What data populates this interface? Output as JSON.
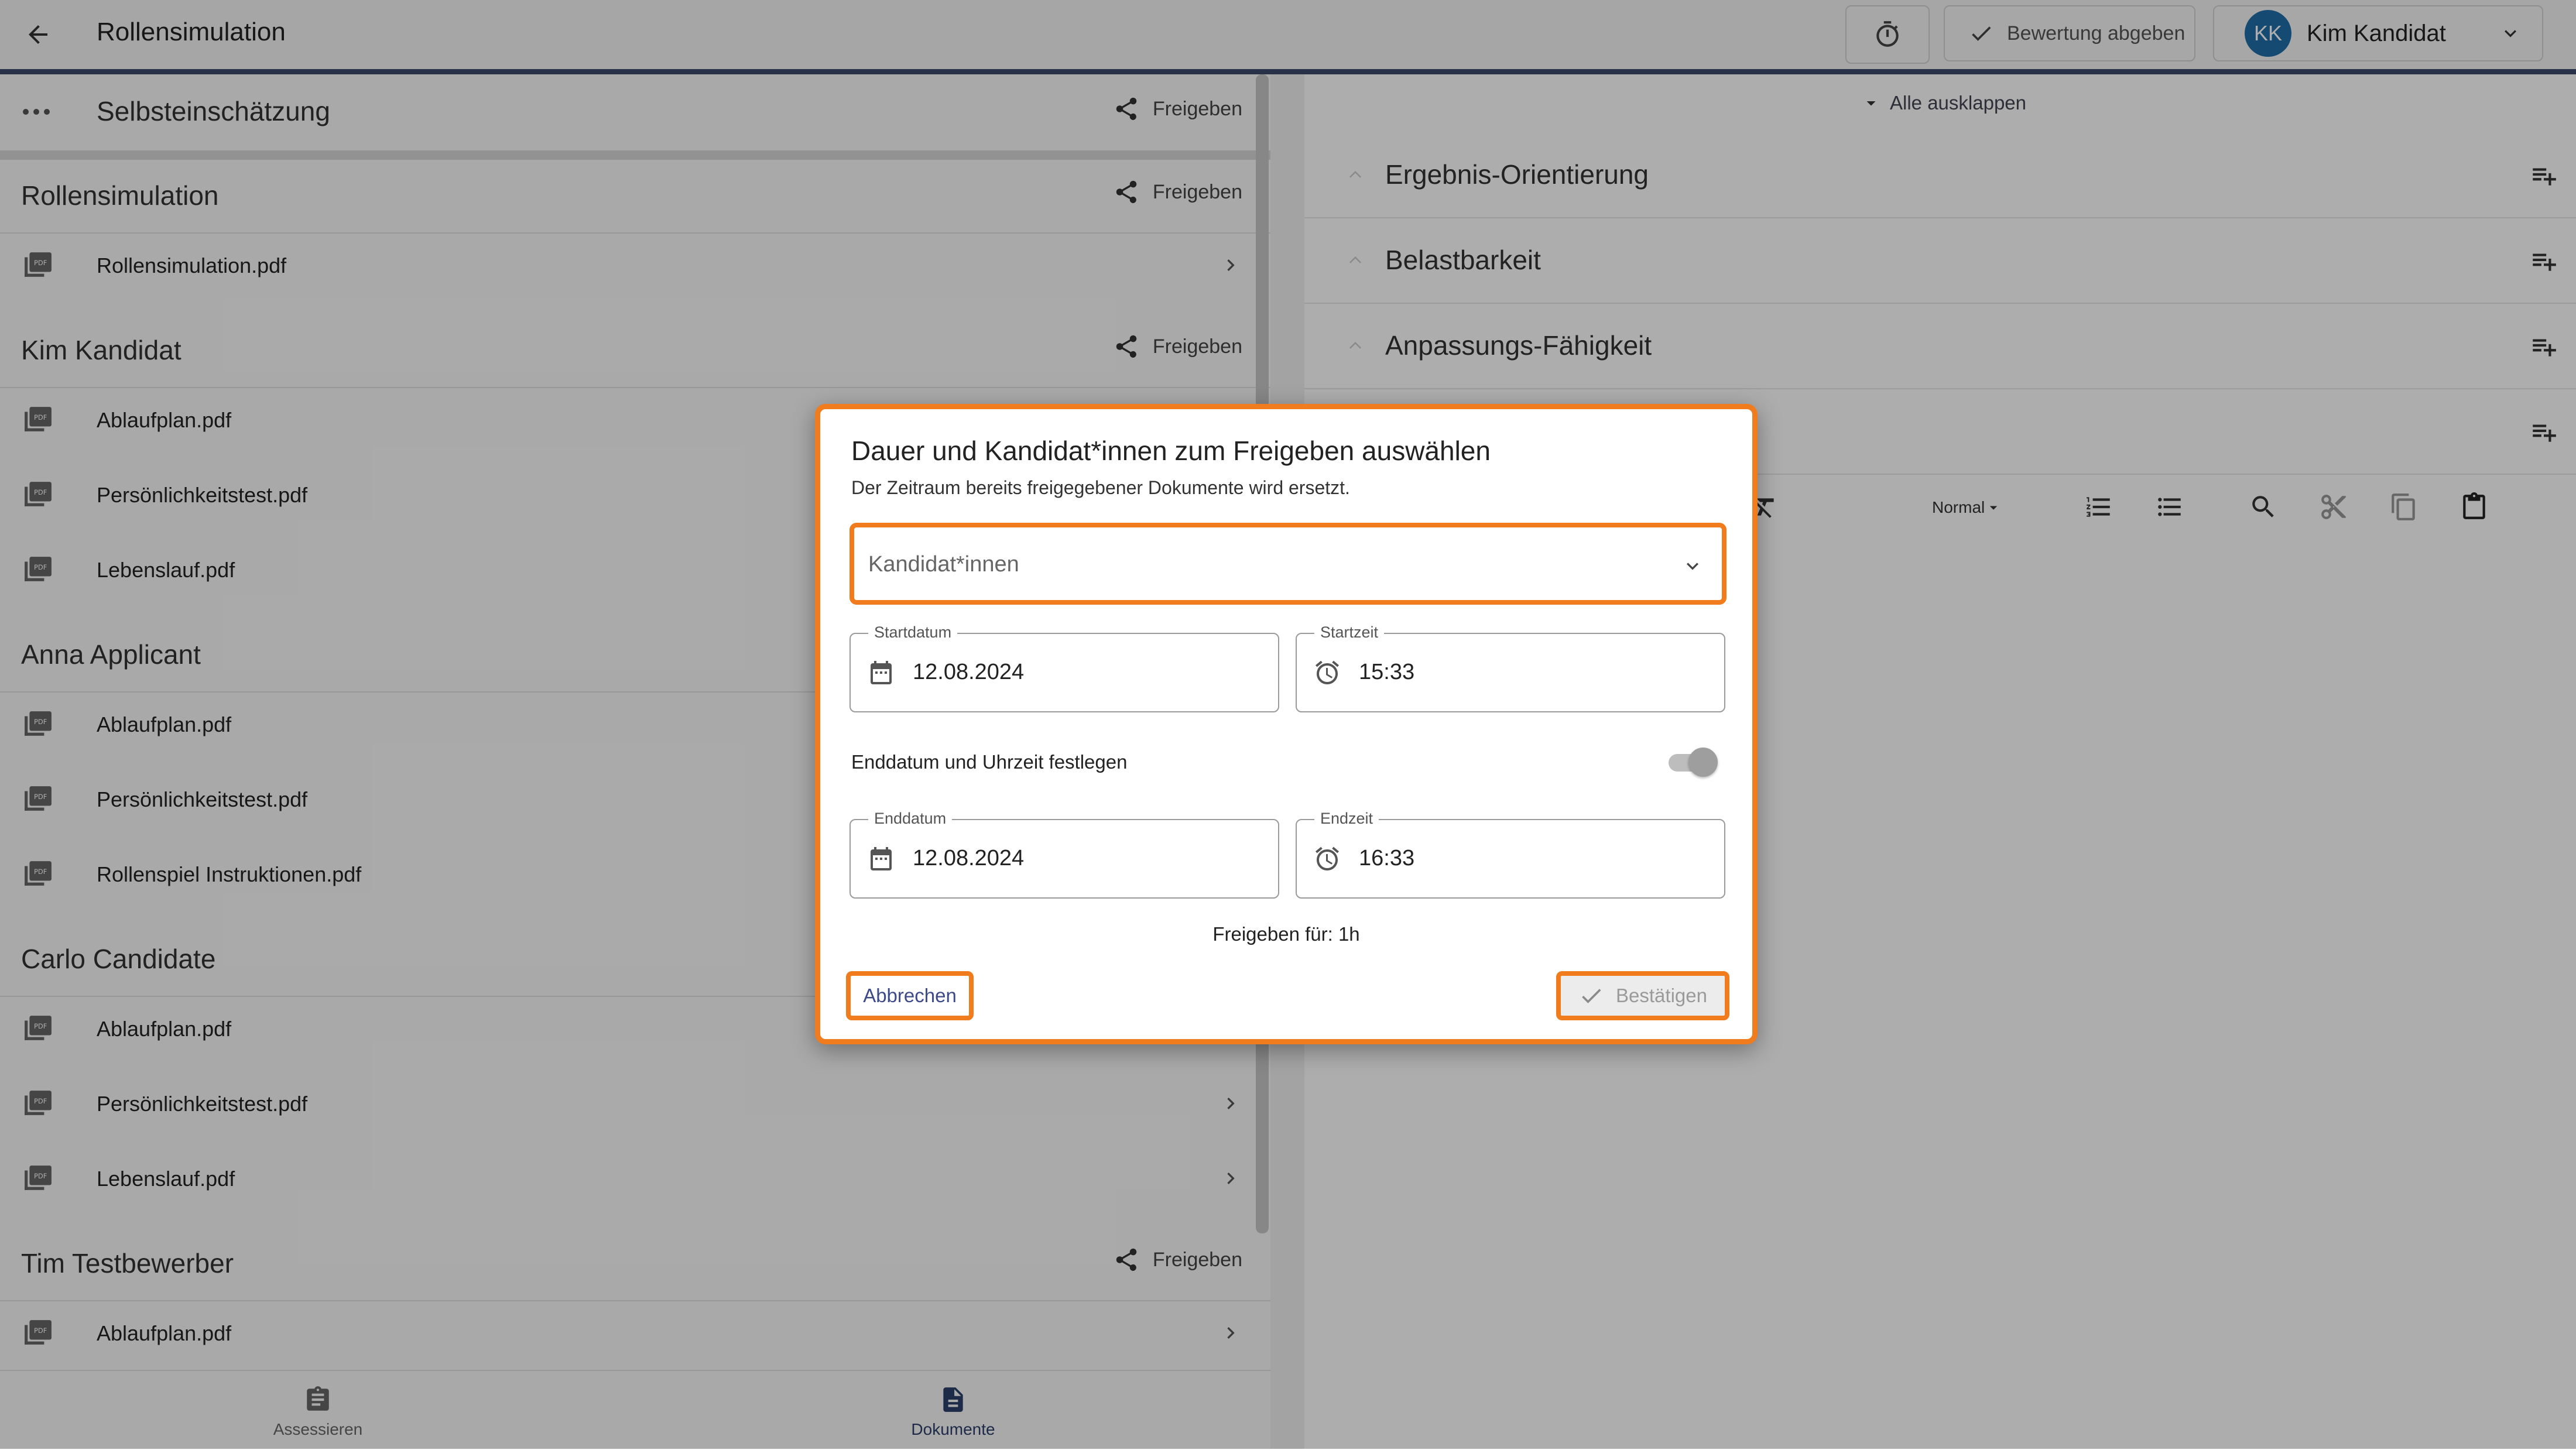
{
  "header": {
    "title": "Rollensimulation",
    "submit_label": "Bewertung abgeben",
    "user_initials": "KK",
    "user_name": "Kim Kandidat"
  },
  "left": {
    "self_assessment": {
      "title": "Selbsteinschätzung",
      "share_label": "Freigeben"
    },
    "sections": [
      {
        "title": "Rollensimulation",
        "share_label": "Freigeben",
        "docs": [
          "Rollensimulation.pdf"
        ]
      },
      {
        "title": "Kim Kandidat",
        "share_label": "Freigeben",
        "docs": [
          "Ablaufplan.pdf",
          "Persönlichkeitstest.pdf",
          "Lebenslauf.pdf"
        ]
      },
      {
        "title": "Anna Applicant",
        "share_label": "",
        "docs": [
          "Ablaufplan.pdf",
          "Persönlichkeitstest.pdf",
          "Rollenspiel Instruktionen.pdf"
        ]
      },
      {
        "title": "Carlo Candidate",
        "share_label": "",
        "docs": [
          "Ablaufplan.pdf",
          "Persönlichkeitstest.pdf",
          "Lebenslauf.pdf"
        ]
      },
      {
        "title": "Tim Testbewerber",
        "share_label": "Freigeben",
        "docs": [
          "Ablaufplan.pdf"
        ]
      }
    ]
  },
  "bottom_nav": {
    "assess_label": "Assessieren",
    "docs_label": "Dokumente"
  },
  "right": {
    "expand_all": "Alle ausklappen",
    "criteria": [
      "Ergebnis-Orientierung",
      "Belastbarkeit",
      "Anpassungs-Fähigkeit"
    ],
    "format_label": "Normal"
  },
  "dialog": {
    "title": "Dauer und Kandidat*innen zum Freigeben auswählen",
    "subtitle": "Der Zeitraum bereits freigegebener Dokumente wird ersetzt.",
    "candidates_placeholder": "Kandidat*innen",
    "start_date_label": "Startdatum",
    "start_date": "12.08.2024",
    "start_time_label": "Startzeit",
    "start_time": "15:33",
    "toggle_label": "Enddatum und Uhrzeit festlegen",
    "toggle_on": true,
    "end_date_label": "Enddatum",
    "end_date": "12.08.2024",
    "end_time_label": "Endzeit",
    "end_time": "16:33",
    "duration": "Freigeben für: 1h",
    "cancel_label": "Abbrechen",
    "confirm_label": "Bestätigen"
  },
  "colors": {
    "accent_orange": "#f07c1e",
    "header_bar": "#3a4a6b",
    "avatar": "#1f6fa8"
  }
}
